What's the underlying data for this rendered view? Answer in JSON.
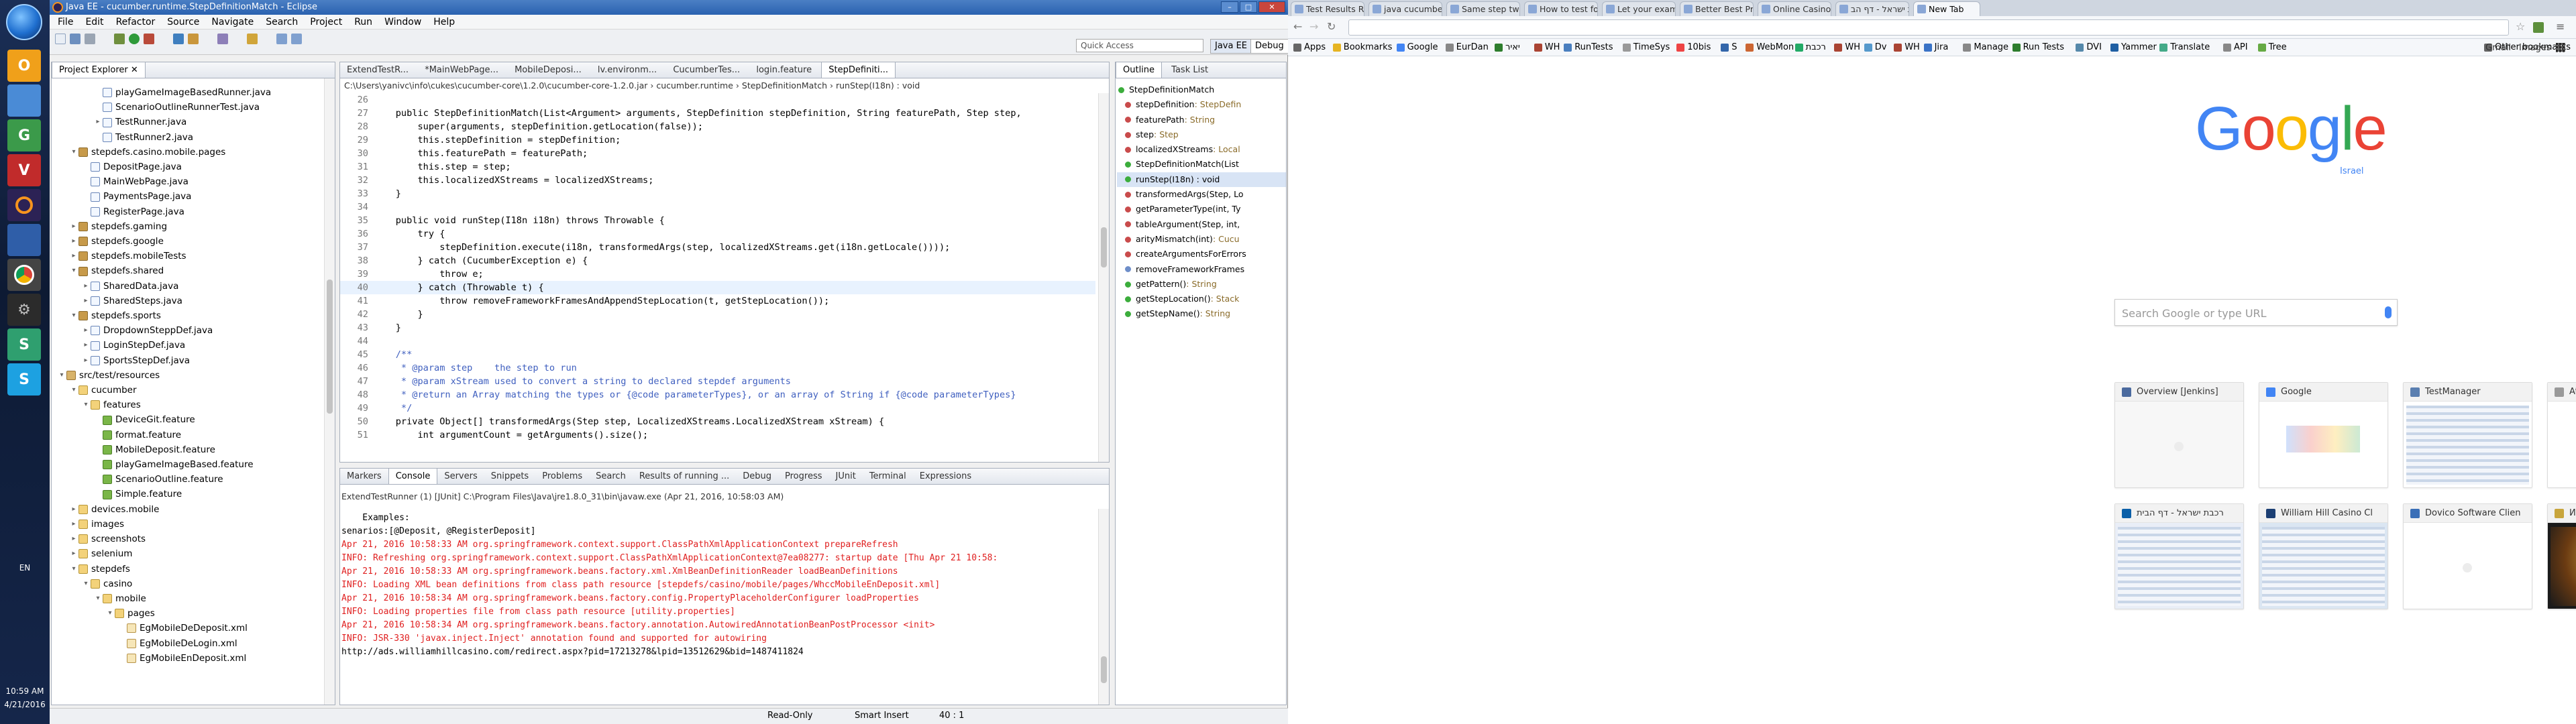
{
  "taskbar": {
    "lang": "EN",
    "time": "10:59 AM",
    "date": "4/21/2016"
  },
  "eclipse": {
    "title": "Java EE - cucumber.runtime.StepDefinitionMatch - Eclipse",
    "menu": [
      "File",
      "Edit",
      "Refactor",
      "Source",
      "Navigate",
      "Search",
      "Project",
      "Run",
      "Window",
      "Help"
    ],
    "quick_access": "Quick Access",
    "perspective_javaee": "Java EE",
    "perspective_debug": "Debug",
    "explorer": {
      "tab_label": "Project Explorer",
      "items": [
        {
          "depth": 3,
          "twisty": "",
          "icon": "java",
          "label": "playGameImageBasedRunner.java"
        },
        {
          "depth": 3,
          "twisty": "",
          "icon": "java",
          "label": "ScenarioOutlineRunnerTest.java"
        },
        {
          "depth": 3,
          "twisty": "▸",
          "icon": "java",
          "label": "TestRunner.java"
        },
        {
          "depth": 3,
          "twisty": "",
          "icon": "java",
          "label": "TestRunner2.java"
        },
        {
          "depth": 1,
          "twisty": "▾",
          "icon": "pkg",
          "label": "stepdefs.casino.mobile.pages"
        },
        {
          "depth": 2,
          "twisty": "",
          "icon": "java",
          "label": "DepositPage.java"
        },
        {
          "depth": 2,
          "twisty": "",
          "icon": "java",
          "label": "MainWebPage.java"
        },
        {
          "depth": 2,
          "twisty": "",
          "icon": "java",
          "label": "PaymentsPage.java"
        },
        {
          "depth": 2,
          "twisty": "",
          "icon": "java",
          "label": "RegisterPage.java"
        },
        {
          "depth": 1,
          "twisty": "▸",
          "icon": "pkg",
          "label": "stepdefs.gaming"
        },
        {
          "depth": 1,
          "twisty": "▸",
          "icon": "pkg",
          "label": "stepdefs.google"
        },
        {
          "depth": 1,
          "twisty": "▸",
          "icon": "pkg",
          "label": "stepdefs.mobileTests"
        },
        {
          "depth": 1,
          "twisty": "▾",
          "icon": "pkg",
          "label": "stepdefs.shared"
        },
        {
          "depth": 2,
          "twisty": "▸",
          "icon": "java",
          "label": "SharedData.java"
        },
        {
          "depth": 2,
          "twisty": "▸",
          "icon": "java",
          "label": "SharedSteps.java"
        },
        {
          "depth": 1,
          "twisty": "▾",
          "icon": "pkg",
          "label": "stepdefs.sports"
        },
        {
          "depth": 2,
          "twisty": "▸",
          "icon": "java",
          "label": "DropdownSteppDef.java"
        },
        {
          "depth": 2,
          "twisty": "▸",
          "icon": "java",
          "label": "LoginStepDef.java"
        },
        {
          "depth": 2,
          "twisty": "▸",
          "icon": "java",
          "label": "SportsStepDef.java"
        },
        {
          "depth": 0,
          "twisty": "▾",
          "icon": "src",
          "label": "src/test/resources"
        },
        {
          "depth": 1,
          "twisty": "▾",
          "icon": "fold",
          "label": "cucumber"
        },
        {
          "depth": 2,
          "twisty": "▾",
          "icon": "fold",
          "label": "features"
        },
        {
          "depth": 3,
          "twisty": "",
          "icon": "feat",
          "label": "DeviceGit.feature"
        },
        {
          "depth": 3,
          "twisty": "",
          "icon": "feat",
          "label": "format.feature"
        },
        {
          "depth": 3,
          "twisty": "",
          "icon": "feat",
          "label": "MobileDeposit.feature"
        },
        {
          "depth": 3,
          "twisty": "",
          "icon": "feat",
          "label": "playGameImageBased.feature"
        },
        {
          "depth": 3,
          "twisty": "",
          "icon": "feat",
          "label": "ScenarioOutline.feature"
        },
        {
          "depth": 3,
          "twisty": "",
          "icon": "feat",
          "label": "Simple.feature"
        },
        {
          "depth": 1,
          "twisty": "▸",
          "icon": "fold",
          "label": "devices.mobile"
        },
        {
          "depth": 1,
          "twisty": "▸",
          "icon": "fold",
          "label": "images"
        },
        {
          "depth": 1,
          "twisty": "▸",
          "icon": "fold",
          "label": "screenshots"
        },
        {
          "depth": 1,
          "twisty": "▸",
          "icon": "fold",
          "label": "selenium"
        },
        {
          "depth": 1,
          "twisty": "▾",
          "icon": "fold",
          "label": "stepdefs"
        },
        {
          "depth": 2,
          "twisty": "▾",
          "icon": "fold",
          "label": "casino"
        },
        {
          "depth": 3,
          "twisty": "▾",
          "icon": "fold",
          "label": "mobile"
        },
        {
          "depth": 4,
          "twisty": "▾",
          "icon": "fold",
          "label": "pages"
        },
        {
          "depth": 5,
          "twisty": "",
          "icon": "xml",
          "label": "EgMobileDeDeposit.xml"
        },
        {
          "depth": 5,
          "twisty": "",
          "icon": "xml",
          "label": "EgMobileDeLogin.xml"
        },
        {
          "depth": 5,
          "twisty": "",
          "icon": "xml",
          "label": "EgMobileEnDeposit.xml"
        }
      ]
    },
    "editor": {
      "tabs": [
        "ExtendTestR...",
        "*MainWebPage...",
        "MobileDeposi...",
        "lv.environm...",
        "CucumberTes...",
        "login.feature",
        "StepDefiniti..."
      ],
      "breadcrumb": [
        "C:\\Users\\yanivc\\info\\cukes\\cucumber-core\\1.2.0\\cucumber-core-1.2.0.jar",
        "cucumber.runtime",
        "StepDefinitionMatch",
        "runStep(I18n) : void"
      ],
      "lines": [
        {
          "n": "26",
          "t": ""
        },
        {
          "n": "27",
          "t": "    public StepDefinitionMatch(List<Argument> arguments, StepDefinition stepDefinition, String featurePath, Step step,"
        },
        {
          "n": "28",
          "t": "        super(arguments, stepDefinition.getLocation(false));"
        },
        {
          "n": "29",
          "t": "        this.stepDefinition = stepDefinition;"
        },
        {
          "n": "30",
          "t": "        this.featurePath = featurePath;"
        },
        {
          "n": "31",
          "t": "        this.step = step;"
        },
        {
          "n": "32",
          "t": "        this.localizedXStreams = localizedXStreams;"
        },
        {
          "n": "33",
          "t": "    }"
        },
        {
          "n": "34",
          "t": ""
        },
        {
          "n": "35",
          "t": "    public void runStep(I18n i18n) throws Throwable {"
        },
        {
          "n": "36",
          "t": "        try {"
        },
        {
          "n": "37",
          "t": "            stepDefinition.execute(i18n, transformedArgs(step, localizedXStreams.get(i18n.getLocale())));"
        },
        {
          "n": "38",
          "t": "        } catch (CucumberException e) {"
        },
        {
          "n": "39",
          "t": "            throw e;"
        },
        {
          "n": "40",
          "t": "        } catch (Throwable t) {"
        },
        {
          "n": "41",
          "t": "            throw removeFrameworkFramesAndAppendStepLocation(t, getStepLocation());"
        },
        {
          "n": "42",
          "t": "        }"
        },
        {
          "n": "43",
          "t": "    }"
        },
        {
          "n": "44",
          "t": ""
        },
        {
          "n": "45",
          "t": "    /**"
        },
        {
          "n": "46",
          "t": "     * @param step    the step to run"
        },
        {
          "n": "47",
          "t": "     * @param xStream used to convert a string to declared stepdef arguments"
        },
        {
          "n": "48",
          "t": "     * @return an Array matching the types or {@code parameterTypes}, or an array of String if {@code parameterTypes}"
        },
        {
          "n": "49",
          "t": "     */"
        },
        {
          "n": "50",
          "t": "    private Object[] transformedArgs(Step step, LocalizedXStreams.LocalizedXStream xStream) {"
        },
        {
          "n": "51",
          "t": "        int argumentCount = getArguments().size();"
        }
      ]
    },
    "outline": {
      "tabs": [
        "Outline",
        "Task List"
      ],
      "root": "StepDefinitionMatch",
      "items": [
        {
          "c": "r",
          "name": "stepDefinition",
          "type": " : StepDefin"
        },
        {
          "c": "r",
          "name": "featurePath",
          "type": " : String"
        },
        {
          "c": "r",
          "name": "step",
          "type": " : Step"
        },
        {
          "c": "r",
          "name": "localizedXStreams",
          "type": " : Local"
        },
        {
          "c": "g",
          "name": "StepDefinitionMatch(List",
          "type": ""
        },
        {
          "c": "g",
          "name": "runStep(I18n) : void",
          "type": ""
        },
        {
          "c": "r",
          "name": "transformedArgs(Step, Lo",
          "type": ""
        },
        {
          "c": "r",
          "name": "getParameterType(int, Ty",
          "type": ""
        },
        {
          "c": "r",
          "name": "tableArgument(Step, int,",
          "type": ""
        },
        {
          "c": "r",
          "name": "arityMismatch(int)",
          "type": " : Cucu"
        },
        {
          "c": "r",
          "name": "createArgumentsForErrors",
          "type": ""
        },
        {
          "c": "b",
          "name": "removeFrameworkFrames",
          "type": ""
        },
        {
          "c": "g",
          "name": "getPattern()",
          "type": " : String"
        },
        {
          "c": "g",
          "name": "getStepLocation()",
          "type": " : Stack"
        },
        {
          "c": "g",
          "name": "getStepName()",
          "type": " : String"
        }
      ]
    },
    "console": {
      "tabs": [
        "Markers",
        "Console",
        "Servers",
        "Snippets",
        "Problems",
        "Search",
        "Results of running ...",
        "Debug",
        "Progress",
        "JUnit",
        "Terminal",
        "Expressions"
      ],
      "header": "ExtendTestRunner (1) [JUnit] C:\\Program Files\\Java\\jre1.8.0_31\\bin\\javaw.exe (Apr 21, 2016, 10:58:03 AM)",
      "lines": [
        {
          "red": false,
          "t": "    Examples:"
        },
        {
          "red": false,
          "t": "senarios:[@Deposit, @RegisterDeposit]"
        },
        {
          "red": true,
          "t": "Apr 21, 2016 10:58:33 AM org.springframework.context.support.ClassPathXmlApplicationContext prepareRefresh"
        },
        {
          "red": true,
          "t": "INFO: Refreshing org.springframework.context.support.ClassPathXmlApplicationContext@7ea08277: startup date [Thu Apr 21 10:58:"
        },
        {
          "red": true,
          "t": "Apr 21, 2016 10:58:33 AM org.springframework.beans.factory.xml.XmlBeanDefinitionReader loadBeanDefinitions"
        },
        {
          "red": true,
          "t": "INFO: Loading XML bean definitions from class path resource [stepdefs/casino/mobile/pages/WhccMobileEnDeposit.xml]"
        },
        {
          "red": true,
          "t": "Apr 21, 2016 10:58:34 AM org.springframework.beans.factory.config.PropertyPlaceholderConfigurer loadProperties"
        },
        {
          "red": true,
          "t": "INFO: Loading properties file from class path resource [utility.properties]"
        },
        {
          "red": true,
          "t": "Apr 21, 2016 10:58:34 AM org.springframework.beans.factory.annotation.AutowiredAnnotationBeanPostProcessor <init>"
        },
        {
          "red": true,
          "t": "INFO: JSR-330 'javax.inject.Inject' annotation found and supported for autowiring"
        },
        {
          "red": false,
          "t": "http://ads.williamhillcasino.com/redirect.aspx?pid=17213278&lpid=13512629&bid=1487411824"
        }
      ]
    },
    "status": {
      "mode": "Read-Only",
      "insert": "Smart Insert",
      "pos": "40 : 1"
    }
  },
  "chrome": {
    "tabs": [
      "Test Results Report",
      "java cucumber can",
      "Same step twice in",
      "How to test for sam",
      "Let your examples",
      "Better Best Practic",
      "Online Casino Gam",
      "רכבת ישראל - דף הב",
      "New Tab"
    ],
    "bookmarks": [
      "Apps",
      "Bookmarks",
      "Google",
      "EurDan",
      "יאיר",
      "WH",
      "RunTests",
      "TimeSys",
      "10bis",
      "S",
      "WebMon",
      "רכבת",
      "WH",
      "Dv",
      "WH",
      "Jira",
      "Manage",
      "Run Tests",
      "DVI",
      "Yammer",
      "Translate",
      "API",
      "Tree",
      "Other bookmarks"
    ],
    "top_links": [
      "Gmail",
      "Images"
    ],
    "logo_letters": [
      "G",
      "o",
      "o",
      "g",
      "l",
      "e"
    ],
    "logo_sub": "Israel",
    "search_placeholder": "Search Google or type URL",
    "tiles": [
      "Overview [Jenkins]",
      "Google",
      "TestManager",
      "Attenix Login",
      "רכבת ישראל - דף הבית",
      "William Hill Casino Cl",
      "Dovico Software Clien",
      "Интернет Казино Esk"
    ]
  }
}
